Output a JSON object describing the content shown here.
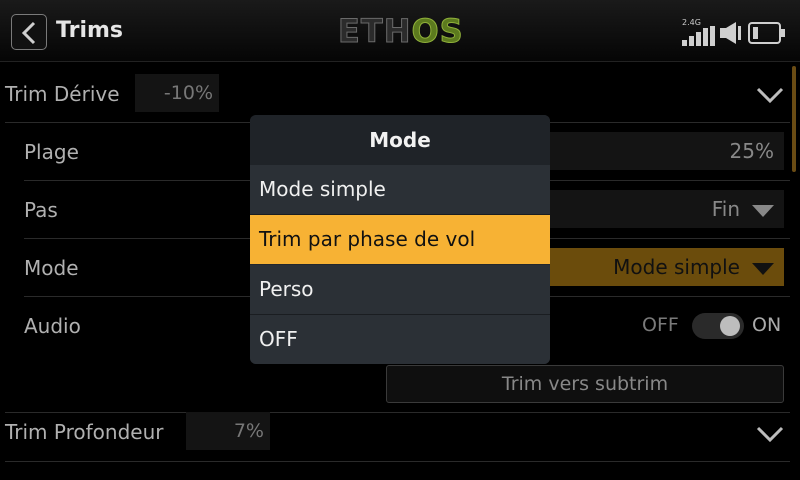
{
  "header": {
    "title": "Trims",
    "logo_part1": "ETH",
    "logo_part2": "OS",
    "rf_label": "2.4G",
    "icons": [
      "back-arrow-icon",
      "signal-bars-icon",
      "speaker-icon",
      "battery-icon"
    ]
  },
  "rows": {
    "trim_derive": {
      "label": "Trim Dérive",
      "value": "-10%"
    },
    "plage": {
      "label": "Plage",
      "value": "25%"
    },
    "pas": {
      "label": "Pas",
      "value": "Fin"
    },
    "mode": {
      "label": "Mode",
      "value": "Mode simple"
    },
    "audio": {
      "label": "Audio",
      "off": "OFF",
      "on": "ON"
    },
    "subtrim_button": "Trim vers subtrim",
    "trim_profondeur": {
      "label": "Trim Profondeur",
      "value": "7%"
    }
  },
  "dialog": {
    "title": "Mode",
    "options": [
      "Mode simple",
      "Trim par phase de vol",
      "Perso",
      "OFF"
    ],
    "selected_index": 1
  },
  "colors": {
    "accent": "#f7b234",
    "dialog_bg": "#2b3036",
    "background": "#000000"
  }
}
